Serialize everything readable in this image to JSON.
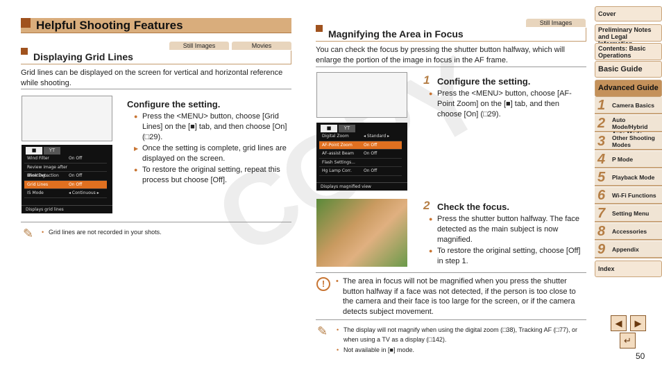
{
  "left": {
    "title": "Helpful Shooting Features",
    "tabs": [
      "Still Images",
      "Movies"
    ],
    "section": "Displaying Grid Lines",
    "intro": "Grid lines can be displayed on the screen for vertical and horizontal reference while shooting.",
    "step_heading": "Configure the setting.",
    "bullets": [
      "Press the <MENU> button, choose [Grid Lines] on the [■] tab, and then choose [On] (□29).",
      "Once the setting is complete, grid lines are displayed on the screen.",
      "To restore the original setting, repeat this process but choose [Off]."
    ],
    "menu": {
      "rows": [
        [
          "Wind Filter",
          "On  Off"
        ],
        [
          "Review image after shooting...",
          ""
        ],
        [
          "Blink Detection",
          "On  Off"
        ],
        [
          "Grid Lines",
          "On  Off"
        ],
        [
          "IS Mode",
          "◂ Continuous ▸"
        ]
      ],
      "selected": 3,
      "footer": "Displays grid lines"
    },
    "note": "Grid lines are not recorded in your shots."
  },
  "right": {
    "tab": "Still Images",
    "section": "Magnifying the Area in Focus",
    "intro": "You can check the focus by pressing the shutter button halfway, which will enlarge the portion of the image in focus in the AF frame.",
    "step1": {
      "num": "1",
      "heading": "Configure the setting.",
      "bullets": [
        "Press the <MENU> button, choose [AF-Point Zoom] on the [■] tab, and then choose [On] (□29)."
      ]
    },
    "menu": {
      "rows": [
        [
          "Digital Zoom",
          "◂ Standard ▸"
        ],
        [
          "AF-Point Zoom",
          "On  Off"
        ],
        [
          "AF-assist Beam",
          "On  Off"
        ],
        [
          "Flash Settings...",
          ""
        ],
        [
          "Hg Lamp Corr.",
          "On  Off"
        ]
      ],
      "selected": 1,
      "footer": "Displays magnified view"
    },
    "step2": {
      "num": "2",
      "heading": "Check the focus.",
      "bullets": [
        "Press the shutter button halfway. The face detected as the main subject is now magnified.",
        "To restore the original setting, choose [Off] in step 1."
      ]
    },
    "caution": "The area in focus will not be magnified when you press the shutter button halfway if a face was not detected, if the person is too close to the camera and their face is too large for the screen, or if the camera detects subject movement.",
    "notes": [
      "The display will not magnify when using the digital zoom (□38), Tracking AF (□77), or when using a TV as a display (□142).",
      "Not available in [■] mode."
    ]
  },
  "sidebar": {
    "cover": "Cover",
    "prelim": "Preliminary Notes and Legal Information",
    "contents": "Contents: Basic Operations",
    "basic": "Basic Guide",
    "advanced": "Advanced Guide",
    "chapters": [
      [
        "1",
        "Camera Basics"
      ],
      [
        "2",
        "Auto Mode/Hybrid Auto Mode"
      ],
      [
        "3",
        "Other Shooting Modes"
      ],
      [
        "4",
        "P Mode"
      ],
      [
        "5",
        "Playback Mode"
      ],
      [
        "6",
        "Wi-Fi Functions"
      ],
      [
        "7",
        "Setting Menu"
      ],
      [
        "8",
        "Accessories"
      ],
      [
        "9",
        "Appendix"
      ]
    ],
    "index": "Index"
  },
  "nav": {
    "prev": "◀",
    "next": "▶",
    "back": "↵"
  },
  "page_number": "50",
  "watermark": "COPY"
}
